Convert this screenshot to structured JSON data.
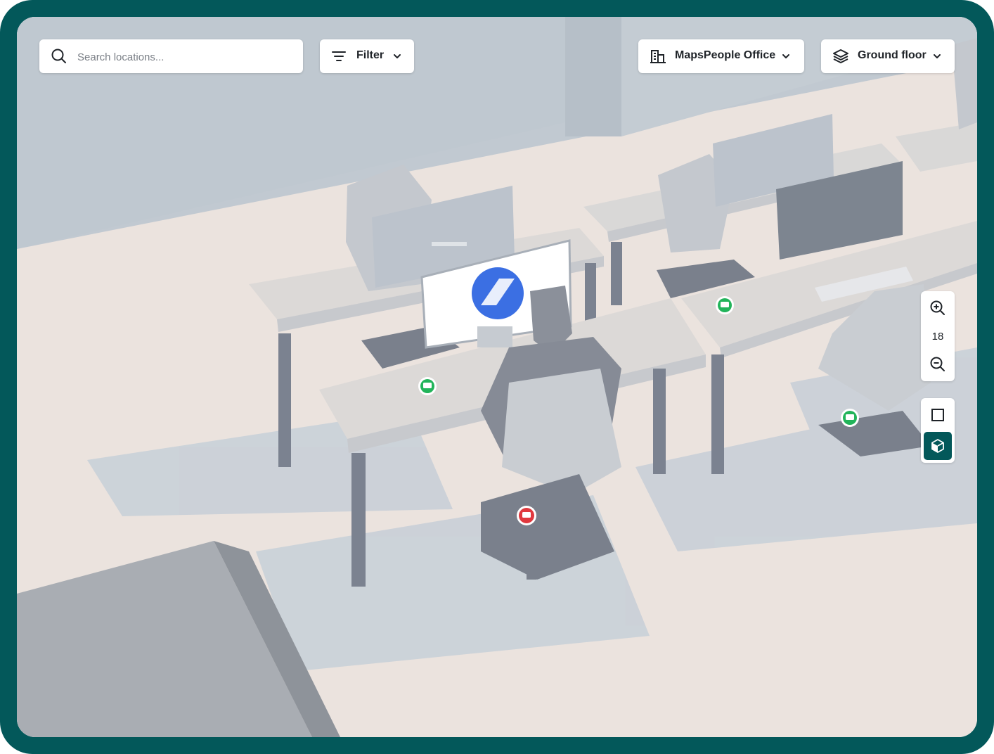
{
  "search": {
    "placeholder": "Search locations...",
    "value": ""
  },
  "filter": {
    "label": "Filter",
    "icon": "filter-lines-icon"
  },
  "venue": {
    "label": "MapsPeople Office",
    "icon": "building-icon"
  },
  "floor": {
    "label": "Ground floor",
    "icon": "layers-icon"
  },
  "zoom": {
    "level": "18"
  },
  "view_mode": {
    "options": [
      "2D",
      "3D"
    ],
    "selected": "3D"
  },
  "map": {
    "markers": [
      {
        "status": "available",
        "color": "#22b45a"
      },
      {
        "status": "available",
        "color": "#22b45a"
      },
      {
        "status": "available",
        "color": "#22b45a"
      },
      {
        "status": "occupied",
        "color": "#e0383e"
      }
    ],
    "accent_color": "#03585a"
  }
}
